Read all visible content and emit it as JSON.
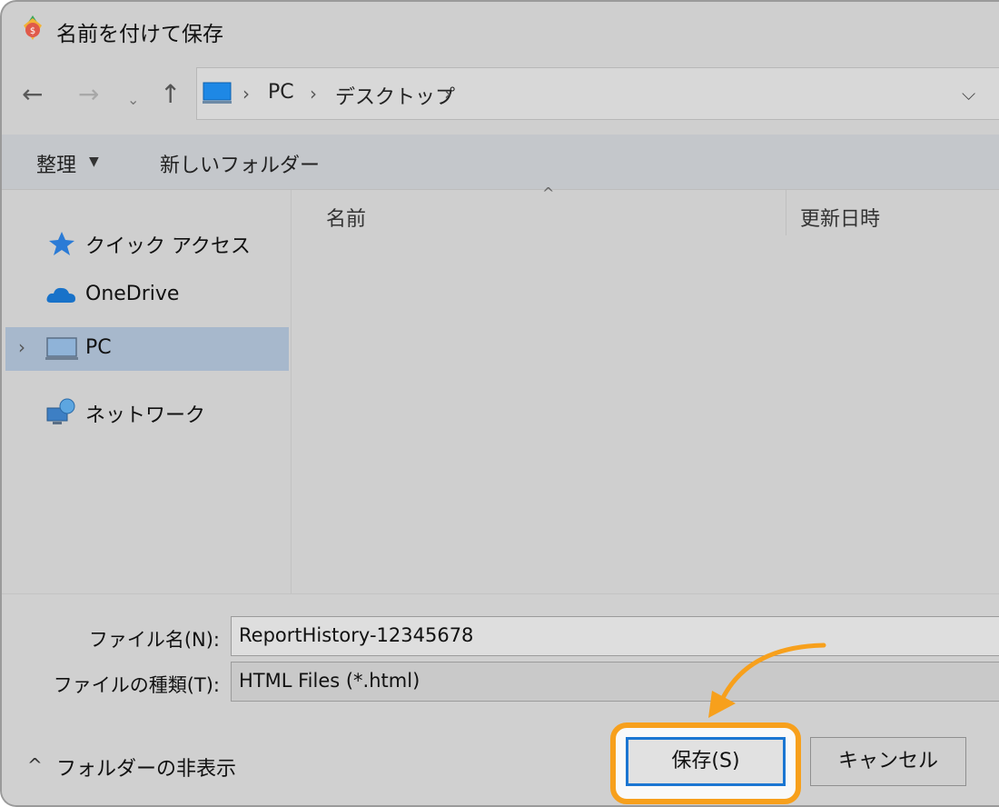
{
  "window": {
    "title": "名前を付けて保存"
  },
  "nav": {
    "back": "←",
    "forward": "→",
    "recent": "⌄",
    "up": "↑"
  },
  "address": {
    "segments": [
      "PC",
      "デスクトップ"
    ],
    "separator": "›"
  },
  "toolbar": {
    "organize": "整理",
    "new_folder": "新しいフォルダー"
  },
  "sidebar": {
    "items": [
      {
        "label": "クイック アクセス",
        "icon": "star-icon"
      },
      {
        "label": "OneDrive",
        "icon": "cloud-icon"
      },
      {
        "label": "PC",
        "icon": "computer-icon",
        "selected": true
      },
      {
        "label": "ネットワーク",
        "icon": "network-icon"
      }
    ]
  },
  "filelist": {
    "columns": [
      "名前",
      "更新日時"
    ]
  },
  "form": {
    "filename_label": "ファイル名(N):",
    "filename_value": "ReportHistory-12345678",
    "filetype_label": "ファイルの種類(T):",
    "filetype_value": "HTML Files (*.html)"
  },
  "footer": {
    "hide_folders": "フォルダーの非表示",
    "save_label": "保存(S)",
    "cancel_label": "キャンセル"
  },
  "colors": {
    "highlight": "#f7a01c",
    "focus": "#1b76d2",
    "selected": "#a7b8cc"
  }
}
